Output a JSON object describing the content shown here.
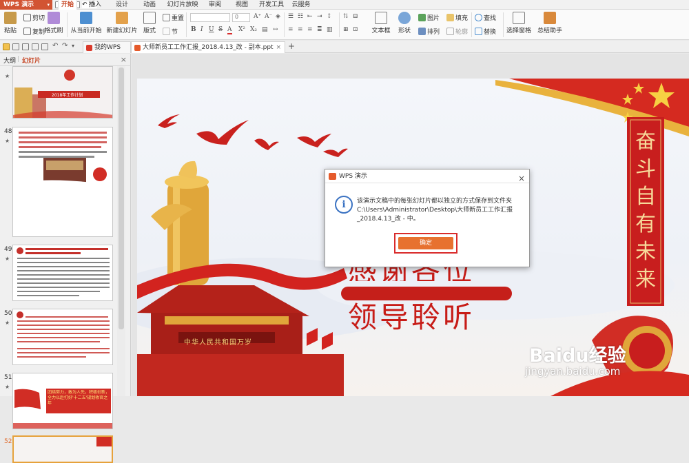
{
  "app": {
    "name": "WPS 演示"
  },
  "menu": [
    "开始",
    "插入",
    "设计",
    "动画",
    "幻灯片放映",
    "审阅",
    "视图",
    "开发工具",
    "云服务"
  ],
  "ribbon": {
    "paste": "粘贴",
    "cut": "剪切",
    "copy": "复制",
    "format_painter": "格式刷",
    "from_current": "从当前开始",
    "new_slide": "新建幻灯片",
    "layout": "版式",
    "reset": "重置",
    "section": "节",
    "textbox": "文本框",
    "shape": "形状",
    "arrange": "排列",
    "picture": "图片",
    "fill": "填充",
    "outline": "轮廓",
    "find": "查找",
    "replace": "替换",
    "select_pane": "选择窗格",
    "assistant": "总结助手",
    "font_size_value": "0"
  },
  "tabs": {
    "home": "我的WPS",
    "document": "大师新员工工作汇报_2018.4.13_改 - 副本.ppt"
  },
  "panel": {
    "outline_tab": "大纲",
    "slides_tab": "幻灯片",
    "slides": [
      {
        "num": "",
        "title": "2018年工作计划"
      },
      {
        "num": "48"
      },
      {
        "num": "49"
      },
      {
        "num": "50"
      },
      {
        "num": "51",
        "banner": "团结努力，敢为人先，积极创新，全力以赴打好'十二五'规划收官之年"
      },
      {
        "num": "52"
      }
    ]
  },
  "slide": {
    "vertical_banner": [
      "奋",
      "斗",
      "自",
      "有",
      "未",
      "来"
    ],
    "line1": "感谢各位",
    "line2": "领导聆听",
    "gate_caption": "中华人民共和国万岁"
  },
  "dialog": {
    "title": "WPS 演示",
    "message": "该演示文稿中的每张幻灯片都以独立的方式保存到文件夹 C:\\Users\\Administrator\\Desktop\\大师新员工工作汇报_2018.4.13_改 - 中。",
    "ok": "确定"
  },
  "watermark": {
    "logo": "Baidu经验",
    "url": "jingyan.baidu.com"
  }
}
